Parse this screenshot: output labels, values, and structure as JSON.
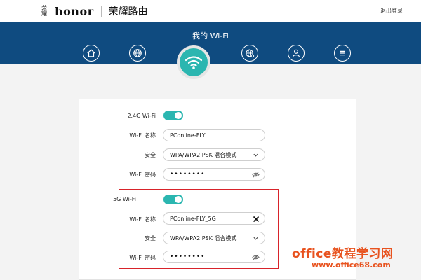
{
  "header": {
    "brand_badge": "荣耀",
    "brand_logo": "honor",
    "title": "荣耀路由",
    "logout": "退出登录"
  },
  "band": {
    "title": "我的 Wi-Fi",
    "nav_icons": [
      "home-icon",
      "globe-icon",
      "wifi-icon",
      "globe-settings-icon",
      "user-icon",
      "menu-icon"
    ]
  },
  "wifi24": {
    "label": "2.4G Wi-Fi",
    "enabled": true,
    "name_label": "Wi-Fi 名称",
    "name_value": "PConline-FLY",
    "security_label": "安全",
    "security_value": "WPA/WPA2 PSK 混合模式",
    "password_label": "Wi-Fi 密码",
    "password_value": "••••••••"
  },
  "wifi5": {
    "label": "5G Wi-Fi",
    "enabled": true,
    "name_label": "Wi-Fi 名称",
    "name_value": "PConline-FLY_5G",
    "security_label": "安全",
    "security_value": "WPA/WPA2 PSK 混合模式",
    "password_label": "Wi-Fi 密码",
    "password_value": "••••••••"
  },
  "colors": {
    "band": "#0f4b80",
    "accent": "#2bb6b0",
    "highlight": "#d8232a",
    "watermark": "#e8521e"
  },
  "watermark": {
    "line1": "office教程学习网",
    "line2": "www.office68.com"
  }
}
